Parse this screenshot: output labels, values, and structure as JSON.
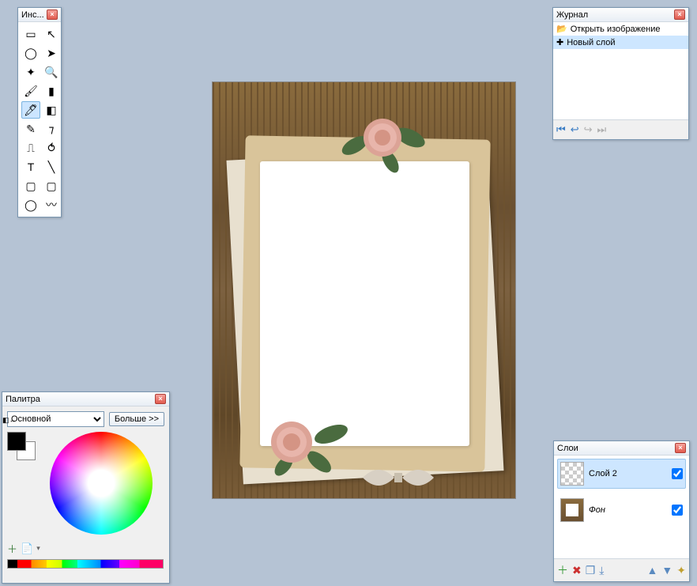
{
  "tools": {
    "title": "Инс...",
    "items": [
      {
        "name": "marquee-rect",
        "glyph": "▭"
      },
      {
        "name": "move",
        "glyph": "↖"
      },
      {
        "name": "lasso",
        "glyph": "◯"
      },
      {
        "name": "pointer",
        "glyph": "➤"
      },
      {
        "name": "magic-wand",
        "glyph": "✦"
      },
      {
        "name": "zoom",
        "glyph": "🔍"
      },
      {
        "name": "brush",
        "glyph": "🖌"
      },
      {
        "name": "gradient",
        "glyph": "▮"
      },
      {
        "name": "paint-brush",
        "glyph": "🖊"
      },
      {
        "name": "eraser",
        "glyph": "◧"
      },
      {
        "name": "pencil",
        "glyph": "✎"
      },
      {
        "name": "dropper",
        "glyph": "⁊"
      },
      {
        "name": "stamp",
        "glyph": "⎍"
      },
      {
        "name": "clone",
        "glyph": "⥀"
      },
      {
        "name": "text",
        "glyph": "T"
      },
      {
        "name": "line",
        "glyph": "╲"
      },
      {
        "name": "rect",
        "glyph": "▢"
      },
      {
        "name": "rounded-rect",
        "glyph": "▢"
      },
      {
        "name": "ellipse",
        "glyph": "◯"
      },
      {
        "name": "freeform",
        "glyph": "〰"
      }
    ],
    "selected_index": 8
  },
  "journal": {
    "title": "Журнал",
    "items": [
      {
        "icon": "folder",
        "label": "Открыть изображение"
      },
      {
        "icon": "layer-add",
        "label": "Новый слой"
      }
    ],
    "selected_index": 1
  },
  "palette": {
    "title": "Палитра",
    "select_options": [
      "Основной"
    ],
    "select_value": "Основной",
    "more_label": "Больше >>",
    "primary_color": "#000000",
    "secondary_color": "#ffffff"
  },
  "layers": {
    "title": "Слои",
    "items": [
      {
        "name": "Слой 2",
        "thumb": "checker",
        "visible": true,
        "selected": true,
        "italic": false
      },
      {
        "name": "Фон",
        "thumb": "doc",
        "visible": true,
        "selected": false,
        "italic": true
      }
    ]
  }
}
